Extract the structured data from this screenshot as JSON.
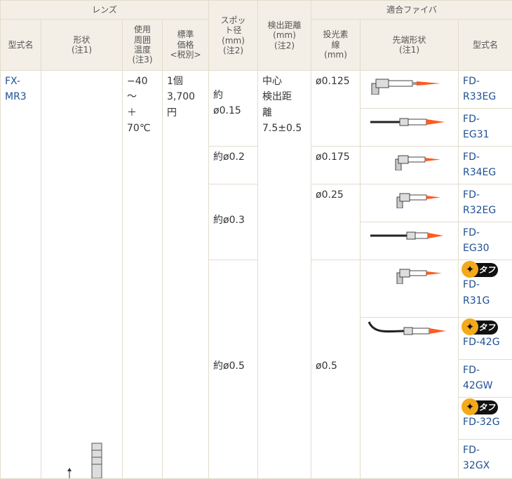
{
  "headers": {
    "lens_group": "レンズ",
    "fiber_group": "適合ファイバ",
    "model": "型式名",
    "shape_a": "形状",
    "shape_b": "(注1)",
    "temp_a": "使用",
    "temp_b": "周囲",
    "temp_c": "温度",
    "temp_d": "(注3)",
    "price_a": "標準",
    "price_b": "価格",
    "price_c": "<税別>",
    "spot_a": "スポッ",
    "spot_b": "ト径",
    "spot_c": "(mm)",
    "spot_d": "(注2)",
    "dist_a": "検出距離",
    "dist_b": "(mm)",
    "dist_c": "(注2)",
    "core_a": "投光素",
    "core_b": "線",
    "core_c": "(mm)",
    "tip_a": "先端形状",
    "tip_b": "(注1)",
    "fmodel": "型式名"
  },
  "lens": {
    "model_a": "FX-",
    "model_b": "MR3",
    "temp_a": "−40",
    "temp_b": "〜",
    "temp_c": "＋",
    "temp_d": "70℃",
    "price_a": "1個",
    "price_b": "3,700",
    "price_c": "円",
    "dist_a": "中心",
    "dist_b": "検出距",
    "dist_c": "離",
    "dist_d": "7.5±0.5"
  },
  "spots": {
    "s1_a": "約",
    "s1_b": "ø0.15",
    "s2": "約ø0.2",
    "s3": "約ø0.3",
    "s4": "約ø0.5"
  },
  "cores": {
    "c1": "ø0.125",
    "c2": "ø0.175",
    "c3": "ø0.25",
    "c4": "ø0.5"
  },
  "tough_label": "タフ",
  "fibers": [
    {
      "a": "FD-",
      "b": "R33EG"
    },
    {
      "a": "FD-",
      "b": "EG31"
    },
    {
      "a": "FD-",
      "b": "R34EG"
    },
    {
      "a": "FD-",
      "b": "R32EG"
    },
    {
      "a": "FD-",
      "b": "EG30"
    },
    {
      "a": "FD-",
      "b": "R31G"
    },
    {
      "a": "FD-42G",
      "b": ""
    },
    {
      "a": "FD-",
      "b": "42GW"
    },
    {
      "a": "FD-32G",
      "b": ""
    },
    {
      "a": "FD-",
      "b": "32GX"
    }
  ],
  "colors": {
    "header_bg": "#f3efe6",
    "link": "#1f4f93",
    "border": "#e3dccd",
    "beam": "#ff5a1f"
  }
}
